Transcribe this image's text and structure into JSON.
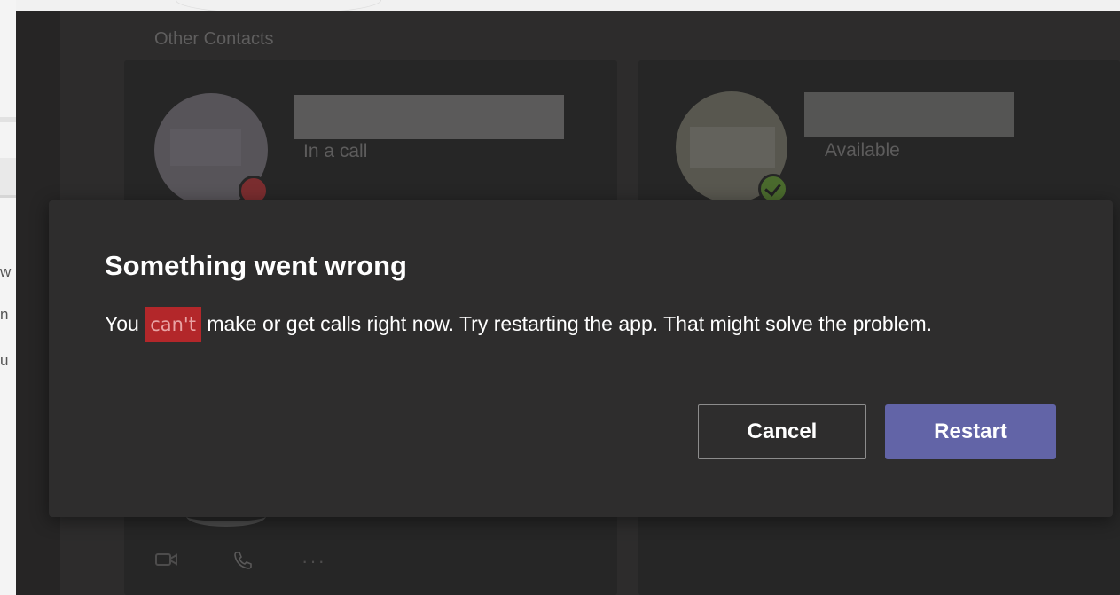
{
  "background_app": {
    "left_fragments": [
      "w",
      "n",
      "u"
    ]
  },
  "contacts": {
    "section_title": "Other Contacts",
    "cards": [
      {
        "status": "In a call",
        "presence": "busy"
      },
      {
        "status": "Available",
        "presence": "available"
      }
    ],
    "action_icons": [
      "video-icon",
      "phone-icon",
      "more-icon"
    ],
    "more_label": "···"
  },
  "dialog": {
    "title": "Something went wrong",
    "message_before": "You ",
    "message_highlight": "can't",
    "message_after": " make or get calls right now. Try restarting the app. That might solve the problem.",
    "cancel_label": "Cancel",
    "restart_label": "Restart"
  },
  "colors": {
    "accent": "#6264a7",
    "highlight": "#b3272a",
    "busy": "#c4314b",
    "available": "#6bb700"
  }
}
